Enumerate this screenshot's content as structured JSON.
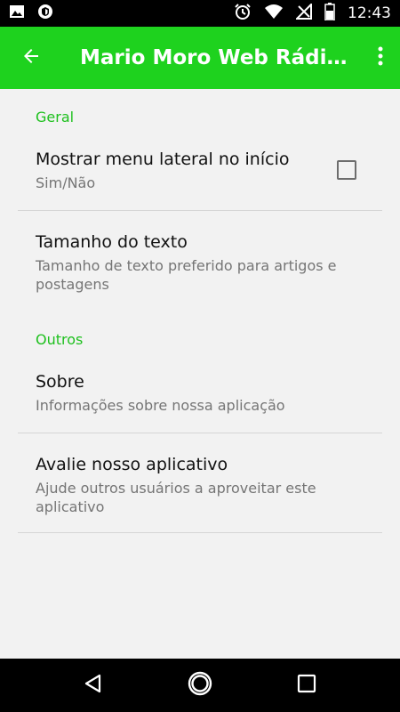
{
  "status_bar": {
    "time": "12:43",
    "left_icons": [
      "image-icon",
      "vpn-shield-icon"
    ],
    "right_icons": [
      "alarm-icon",
      "wifi-icon",
      "no-signal-icon",
      "battery-icon"
    ]
  },
  "app_bar": {
    "title": "Mario Moro Web Rádio T…",
    "background": "#1ed21e"
  },
  "categories": {
    "general": "Geral",
    "others": "Outros"
  },
  "prefs": {
    "show_menu": {
      "title": "Mostrar menu lateral no início",
      "summary": "Sim/Não",
      "checked": false
    },
    "text_size": {
      "title": "Tamanho do texto",
      "summary": "Tamanho de texto preferido para artigos e postagens"
    },
    "about": {
      "title": "Sobre",
      "summary": "Informações sobre nossa aplicação"
    },
    "rate": {
      "title": "Avalie nosso aplicativo",
      "summary": "Ajude outros usuários a aproveitar este aplicativo"
    }
  },
  "nav_bar": {
    "buttons": [
      "back-icon",
      "home-icon",
      "recents-icon"
    ]
  }
}
